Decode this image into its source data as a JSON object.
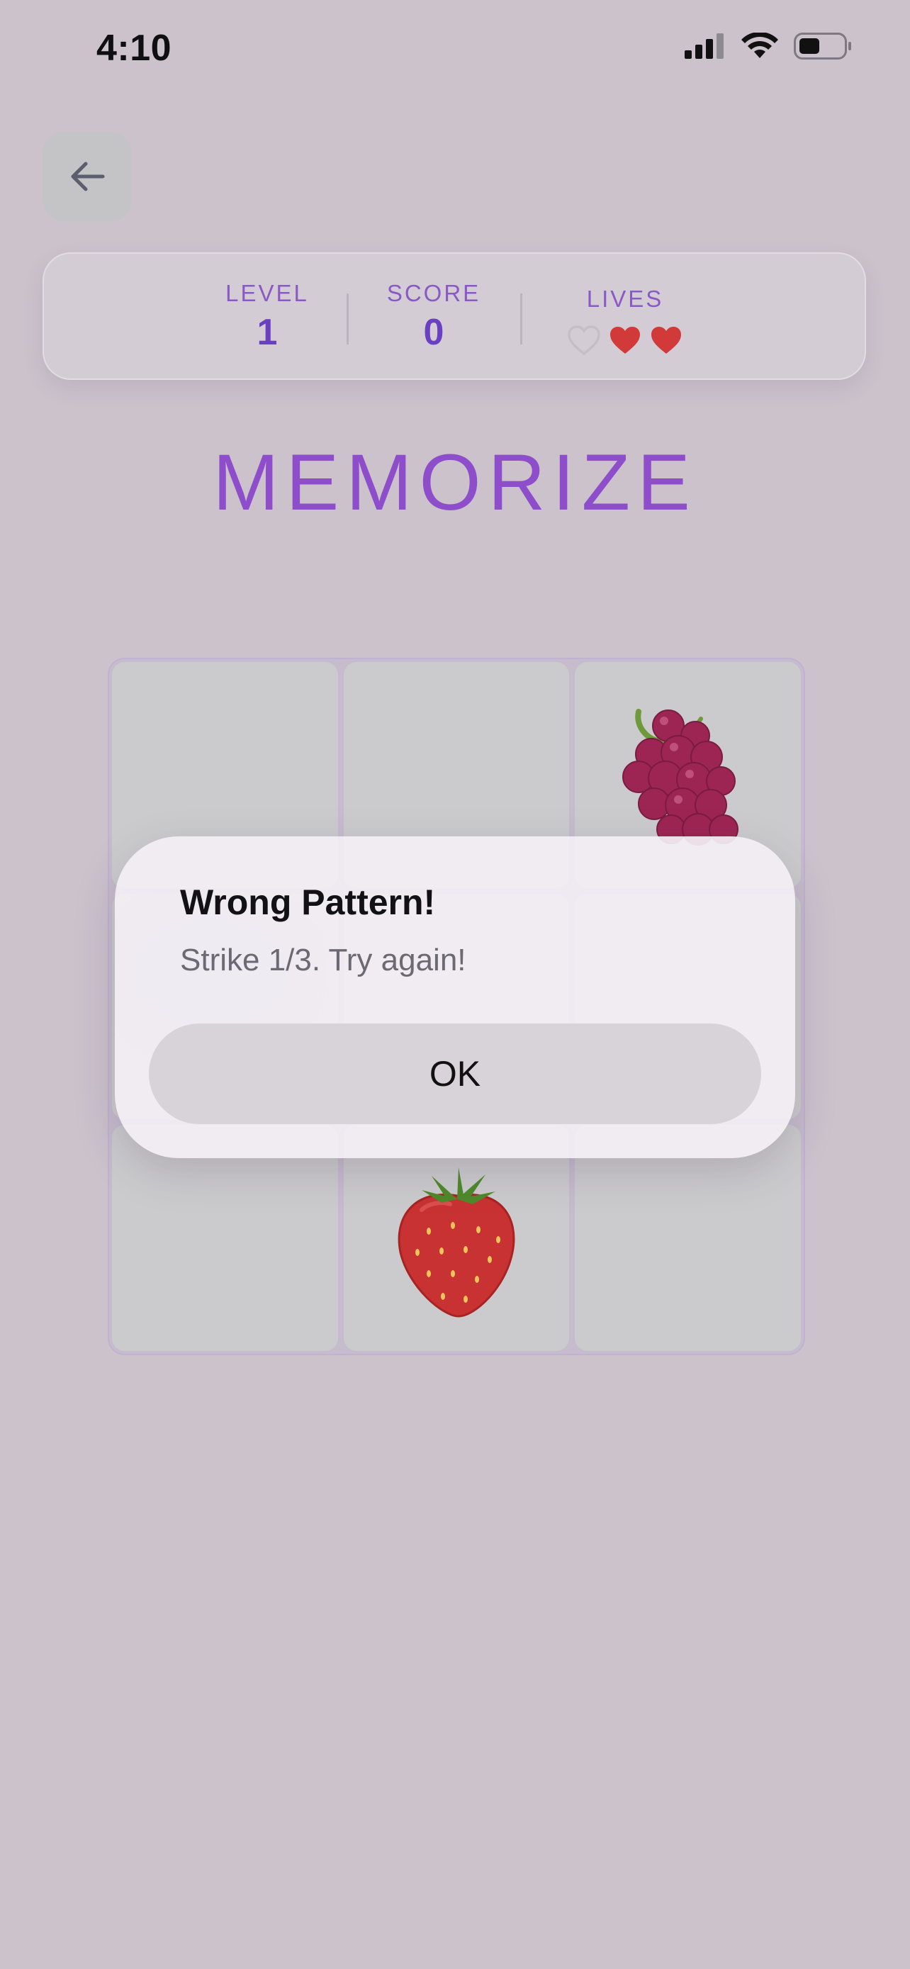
{
  "status_bar": {
    "time": "4:10",
    "icons": [
      "cellular-signal-icon",
      "wifi-icon",
      "battery-icon"
    ]
  },
  "header": {
    "back_icon": "arrow-left-icon"
  },
  "stats": {
    "level_label": "LEVEL",
    "level_value": "1",
    "score_label": "SCORE",
    "score_value": "0",
    "lives_label": "LIVES",
    "lives_total": 3,
    "lives_remaining": 2
  },
  "phase_title": "MEMORIZE",
  "grid": {
    "rows": 3,
    "columns": 3,
    "cells": [
      "",
      "",
      "grapes",
      "blurred",
      "",
      "",
      "",
      "strawberry",
      ""
    ]
  },
  "alert": {
    "title": "Wrong Pattern!",
    "message": "Strike 1/3. Try again!",
    "ok_label": "OK"
  },
  "colors": {
    "background": "#cbc2cc",
    "accent_purple": "#8e4ecb",
    "stat_value": "#6a3fc0",
    "heart_full": "#d23a3a",
    "heart_empty": "#c4bfc6"
  }
}
